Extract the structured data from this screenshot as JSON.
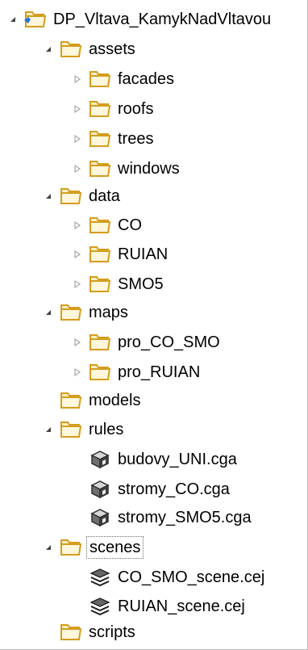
{
  "project_explorer": {
    "items": [
      {
        "label": "DP_Vltava_KamykNadVltavou",
        "type": "project",
        "toggle": "expanded",
        "level": 0
      },
      {
        "label": "assets",
        "type": "folder",
        "toggle": "expanded",
        "level": 1
      },
      {
        "label": "facades",
        "type": "folder",
        "toggle": "collapsed",
        "level": 2
      },
      {
        "label": "roofs",
        "type": "folder",
        "toggle": "collapsed",
        "level": 2
      },
      {
        "label": "trees",
        "type": "folder",
        "toggle": "collapsed",
        "level": 2
      },
      {
        "label": "windows",
        "type": "folder",
        "toggle": "collapsed",
        "level": 2
      },
      {
        "label": "data",
        "type": "folder",
        "toggle": "expanded",
        "level": 1
      },
      {
        "label": "CO",
        "type": "folder",
        "toggle": "collapsed",
        "level": 2
      },
      {
        "label": "RUIAN",
        "type": "folder",
        "toggle": "collapsed",
        "level": 2
      },
      {
        "label": "SMO5",
        "type": "folder",
        "toggle": "collapsed",
        "level": 2
      },
      {
        "label": "maps",
        "type": "folder",
        "toggle": "expanded",
        "level": 1
      },
      {
        "label": "pro_CO_SMO",
        "type": "folder",
        "toggle": "collapsed",
        "level": 2
      },
      {
        "label": "pro_RUIAN",
        "type": "folder",
        "toggle": "collapsed",
        "level": 2
      },
      {
        "label": "models",
        "type": "folder",
        "toggle": "none",
        "level": 1
      },
      {
        "label": "rules",
        "type": "folder",
        "toggle": "expanded",
        "level": 1
      },
      {
        "label": "budovy_UNI.cga",
        "type": "cga-file",
        "toggle": "none",
        "level": 2
      },
      {
        "label": "stromy_CO.cga",
        "type": "cga-file",
        "toggle": "none",
        "level": 2
      },
      {
        "label": "stromy_SMO5.cga",
        "type": "cga-file",
        "toggle": "none",
        "level": 2
      },
      {
        "label": "scenes",
        "type": "folder",
        "toggle": "expanded",
        "level": 1,
        "selected": true
      },
      {
        "label": "CO_SMO_scene.cej",
        "type": "scene-file",
        "toggle": "none",
        "level": 2
      },
      {
        "label": "RUIAN_scene.cej",
        "type": "scene-file",
        "toggle": "none",
        "level": 2
      },
      {
        "label": "scripts",
        "type": "folder",
        "toggle": "none",
        "level": 1
      }
    ]
  },
  "colors": {
    "folder_fill": "#fff0c6",
    "folder_outline": "#d49d1d",
    "project_blue": "#2b74d6",
    "toggle_dark": "#444444",
    "toggle_light": "#a8a8a8",
    "selection_border": "#6b6b6b",
    "panel_border": "#b9b9b9"
  },
  "icons": {
    "project": "project-folder-icon",
    "folder": "folder-icon",
    "cga-file": "cga-file-icon",
    "scene-file": "scene-file-icon",
    "expanded": "expanded-triangle-icon",
    "collapsed": "collapsed-triangle-icon"
  }
}
